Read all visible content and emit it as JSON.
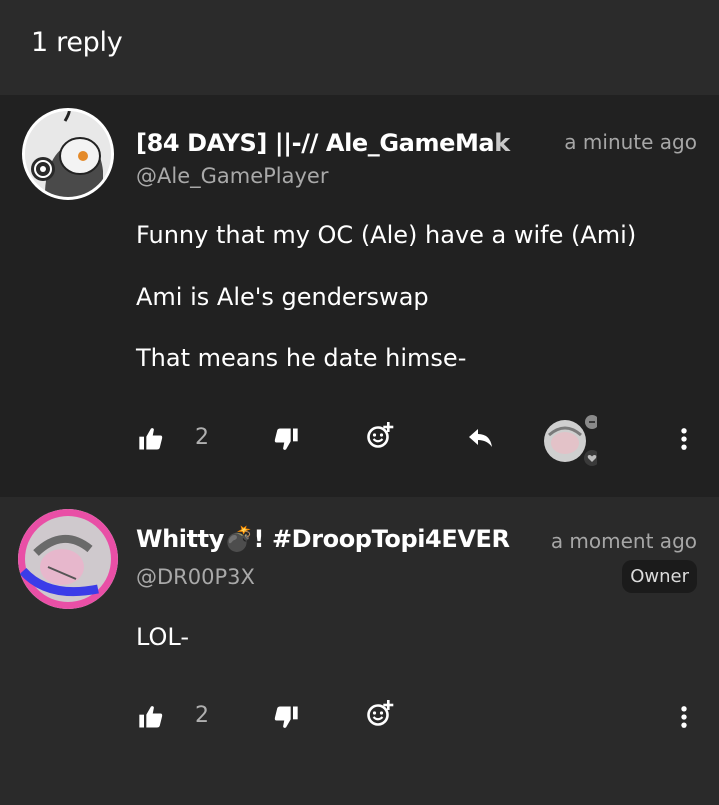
{
  "header": {
    "title": "1 reply"
  },
  "comments": [
    {
      "name_main": "[84 DAYS] ||-// Ale_GameMa",
      "name_fade": "k",
      "time": "a minute ago",
      "handle": "@Ale_GamePlayer",
      "lines": [
        "Funny that my OC (Ale) have a wife (Ami)",
        "Ami is Ale's genderswap",
        "That means he date himse-"
      ],
      "likes": "2"
    },
    {
      "name_main": "Whitty💣! #DroopTopi4EVER",
      "name_fade": "",
      "time": "a moment ago",
      "handle": "@DR00P3X",
      "badge": "Owner",
      "lines": [
        "LOL-"
      ],
      "likes": "2"
    }
  ],
  "colors": {
    "background": "#1f1f1f",
    "header_bg": "#2b2b2b",
    "reply_bg": "#2a2a2a",
    "muted_text": "#a6a6a6",
    "icon": "#ffffff"
  },
  "icons": [
    "like-icon",
    "dislike-icon",
    "add-reaction-icon",
    "reply-icon",
    "more-options-icon",
    "heart-icon",
    "chat-bubble-icon"
  ]
}
